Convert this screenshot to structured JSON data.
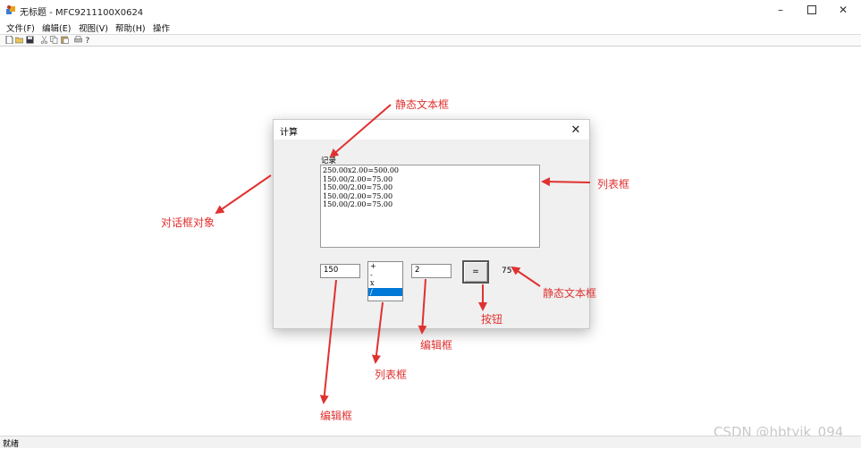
{
  "window": {
    "title": "无标题 - MFC9211100X0624"
  },
  "menu": [
    "文件(F)",
    "编辑(E)",
    "视图(V)",
    "帮助(H)",
    "操作"
  ],
  "status": {
    "text": "就绪"
  },
  "dialog": {
    "title": "计算",
    "record_label": "记录",
    "records": [
      "250.00x2.00=500.00",
      "150.00/2.00=75.00",
      "150.00/2.00=75.00",
      "150.00/2.00=75.00",
      "150.00/2.00=75.00"
    ],
    "operand1": "150",
    "operators": [
      "+",
      "-",
      "x",
      "/"
    ],
    "selected_operator": "/",
    "operand2": "2",
    "equals_label": "=",
    "result": "75"
  },
  "annotations": {
    "static_text_top": "静态文本框",
    "list_box_right": "列表框",
    "dialog_object": "对话框对象",
    "static_text_right": "静态文本框",
    "button": "按钮",
    "edit_box_mid": "编辑框",
    "list_box_bottom": "列表框",
    "edit_box_bottom": "编辑框"
  },
  "watermark": "CSDN @hbtyjk_094",
  "colors": {
    "annotation": "#e03131",
    "selection": "#0078d7"
  }
}
